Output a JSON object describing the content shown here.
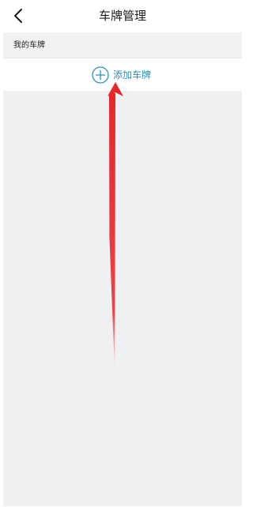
{
  "nav": {
    "title": "车牌管理",
    "back_icon": "chevron-left-icon"
  },
  "section": {
    "label": "我的车牌"
  },
  "add_plate": {
    "label": "添加车牌",
    "icon": "plus-circle-icon",
    "color": "#2a8fbd"
  },
  "annotation": {
    "arrow_color": "#e8262a"
  }
}
